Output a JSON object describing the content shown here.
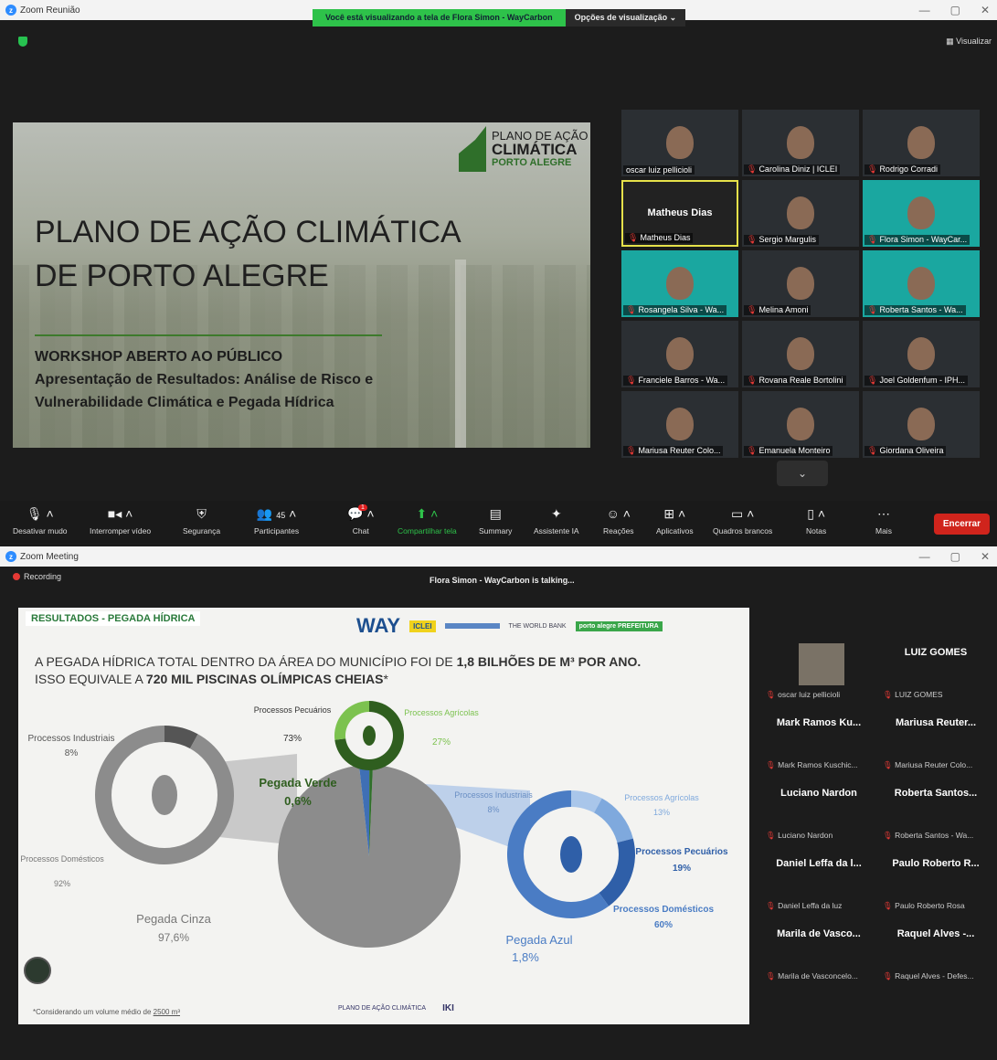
{
  "top_window": {
    "title": "Zoom Reunião",
    "view_banner": "Você está visualizando a tela de Flora Simon - WayCarbon",
    "view_options": "Opções de visualização",
    "view_button": "Visualizar",
    "slide": {
      "logo_line1": "PLANO DE AÇÃO",
      "logo_line2": "CLIMÁTICA",
      "logo_line3": "PORTO ALEGRE",
      "title_line1": "PLANO DE AÇÃO CLIMÁTICA",
      "title_line2": "DE PORTO ALEGRE",
      "subtitle1": "WORKSHOP ABERTO AO PÚBLICO",
      "subtitle2": "Apresentação de Resultados: Análise de Risco e",
      "subtitle3": "Vulnerabilidade Climática e Pegada Hídrica"
    },
    "participants": [
      {
        "name": "oscar luiz pellicioli"
      },
      {
        "name": "Carolina Diniz | ICLEI"
      },
      {
        "name": "Rodrigo Corradi"
      },
      {
        "name": "Matheus Dias",
        "center": "Matheus Dias"
      },
      {
        "name": "Sergio Margulis"
      },
      {
        "name": "Flora Simon - WayCar..."
      },
      {
        "name": "Rosangela Silva - Wa..."
      },
      {
        "name": "Melina Amoni"
      },
      {
        "name": "Roberta Santos - Wa..."
      },
      {
        "name": "Franciele Barros - Wa..."
      },
      {
        "name": "Rovana Reale Bortolini"
      },
      {
        "name": "Joel Goldenfum - IPH..."
      },
      {
        "name": "Mariusa Reuter Colo..."
      },
      {
        "name": "Emanuela Monteiro"
      },
      {
        "name": "Giordana Oliveira"
      }
    ],
    "toolbar": {
      "mute": "Desativar mudo",
      "video": "Interromper vídeo",
      "security": "Segurança",
      "participants": "Participantes",
      "participants_count": "45",
      "chat": "Chat",
      "chat_badge": "1",
      "share": "Compartilhar tela",
      "summary": "Summary",
      "ai": "Assistente IA",
      "reactions": "Reações",
      "apps": "Aplicativos",
      "whiteboards": "Quadros brancos",
      "notes": "Notas",
      "more": "Mais",
      "end": "Encerrar"
    }
  },
  "bottom_window": {
    "title": "Zoom Meeting",
    "recording": "Recording",
    "talking": "Flora Simon - WayCarbon is talking...",
    "slide": {
      "header": "RESULTADOS - PEGADA HÍDRICA",
      "logo_way": "WAY",
      "logo_iclei": "ICLEI",
      "logo_worldbank": "THE WORLD BANK",
      "logo_pa": "porto alegre PREFEITURA",
      "headline_pre": "A PEGADA HÍDRICA TOTAL DENTRO DA ÁREA DO MUNICÍPIO FOI DE ",
      "headline_bold": "1,8 BILHÕES DE M³ POR ANO.",
      "headline2_pre": "ISSO EQUIVALE A ",
      "headline2_bold": "720 MIL PISCINAS OLÍMPICAS CHEIAS",
      "headline2_post": "*",
      "footnote_pre": "*Considerando um volume médio de ",
      "footnote_link": "2500 m³",
      "bottom_logo1": "PLANO DE AÇÃO CLIMÁTICA",
      "bottom_logo2": "IKI"
    },
    "chart_data": [
      {
        "type": "pie",
        "title": "",
        "categories": [
          "Pegada Cinza",
          "Pegada Azul",
          "Pegada Verde"
        ],
        "values": [
          97.6,
          1.8,
          0.6
        ],
        "labels": [
          "97,6%",
          "1,8%",
          "0,6%"
        ],
        "colors": [
          "#8c8c8c",
          "#3f6fb5",
          "#2f6f2a"
        ]
      },
      {
        "type": "pie",
        "title": "Pegada Cinza",
        "categories": [
          "Processos Industriais",
          "Processos Domésticos"
        ],
        "values": [
          8,
          92
        ],
        "labels": [
          "8%",
          "92%"
        ],
        "colors": [
          "#555555",
          "#8c8c8c"
        ]
      },
      {
        "type": "pie",
        "title": "Pegada Verde",
        "categories": [
          "Processos Pecuários",
          "Processos Agrícolas"
        ],
        "values": [
          73,
          27
        ],
        "labels": [
          "73%",
          "27%"
        ],
        "colors": [
          "#2f5e1f",
          "#7cc24f"
        ]
      },
      {
        "type": "pie",
        "title": "Pegada Azul",
        "categories": [
          "Processos Industriais",
          "Processos Agrícolas",
          "Processos Pecuários",
          "Processos Domésticos"
        ],
        "values": [
          8,
          13,
          19,
          60
        ],
        "labels": [
          "8%",
          "13%",
          "19%",
          "60%"
        ],
        "colors": [
          "#a9c6ea",
          "#7fa9dd",
          "#2f5fa8",
          "#4a7cc4"
        ]
      }
    ],
    "panel": [
      {
        "big": "",
        "small": "oscar luiz pellicioli",
        "photo": true
      },
      {
        "big": "LUIZ GOMES",
        "small": "LUIZ GOMES"
      },
      {
        "big": "Mark Ramos Ku...",
        "small": "Mark Ramos Kuschic..."
      },
      {
        "big": "Mariusa Reuter...",
        "small": "Mariusa Reuter Colo..."
      },
      {
        "big": "Luciano Nardon",
        "small": "Luciano Nardon"
      },
      {
        "big": "Roberta Santos...",
        "small": "Roberta Santos - Wa..."
      },
      {
        "big": "Daniel Leffa da l...",
        "small": "Daniel Leffa da luz"
      },
      {
        "big": "Paulo Roberto R...",
        "small": "Paulo Roberto Rosa"
      },
      {
        "big": "Marila de Vasco...",
        "small": "Marila de Vasconcelo..."
      },
      {
        "big": "Raquel Alves -...",
        "small": "Raquel Alves - Defes..."
      }
    ]
  }
}
